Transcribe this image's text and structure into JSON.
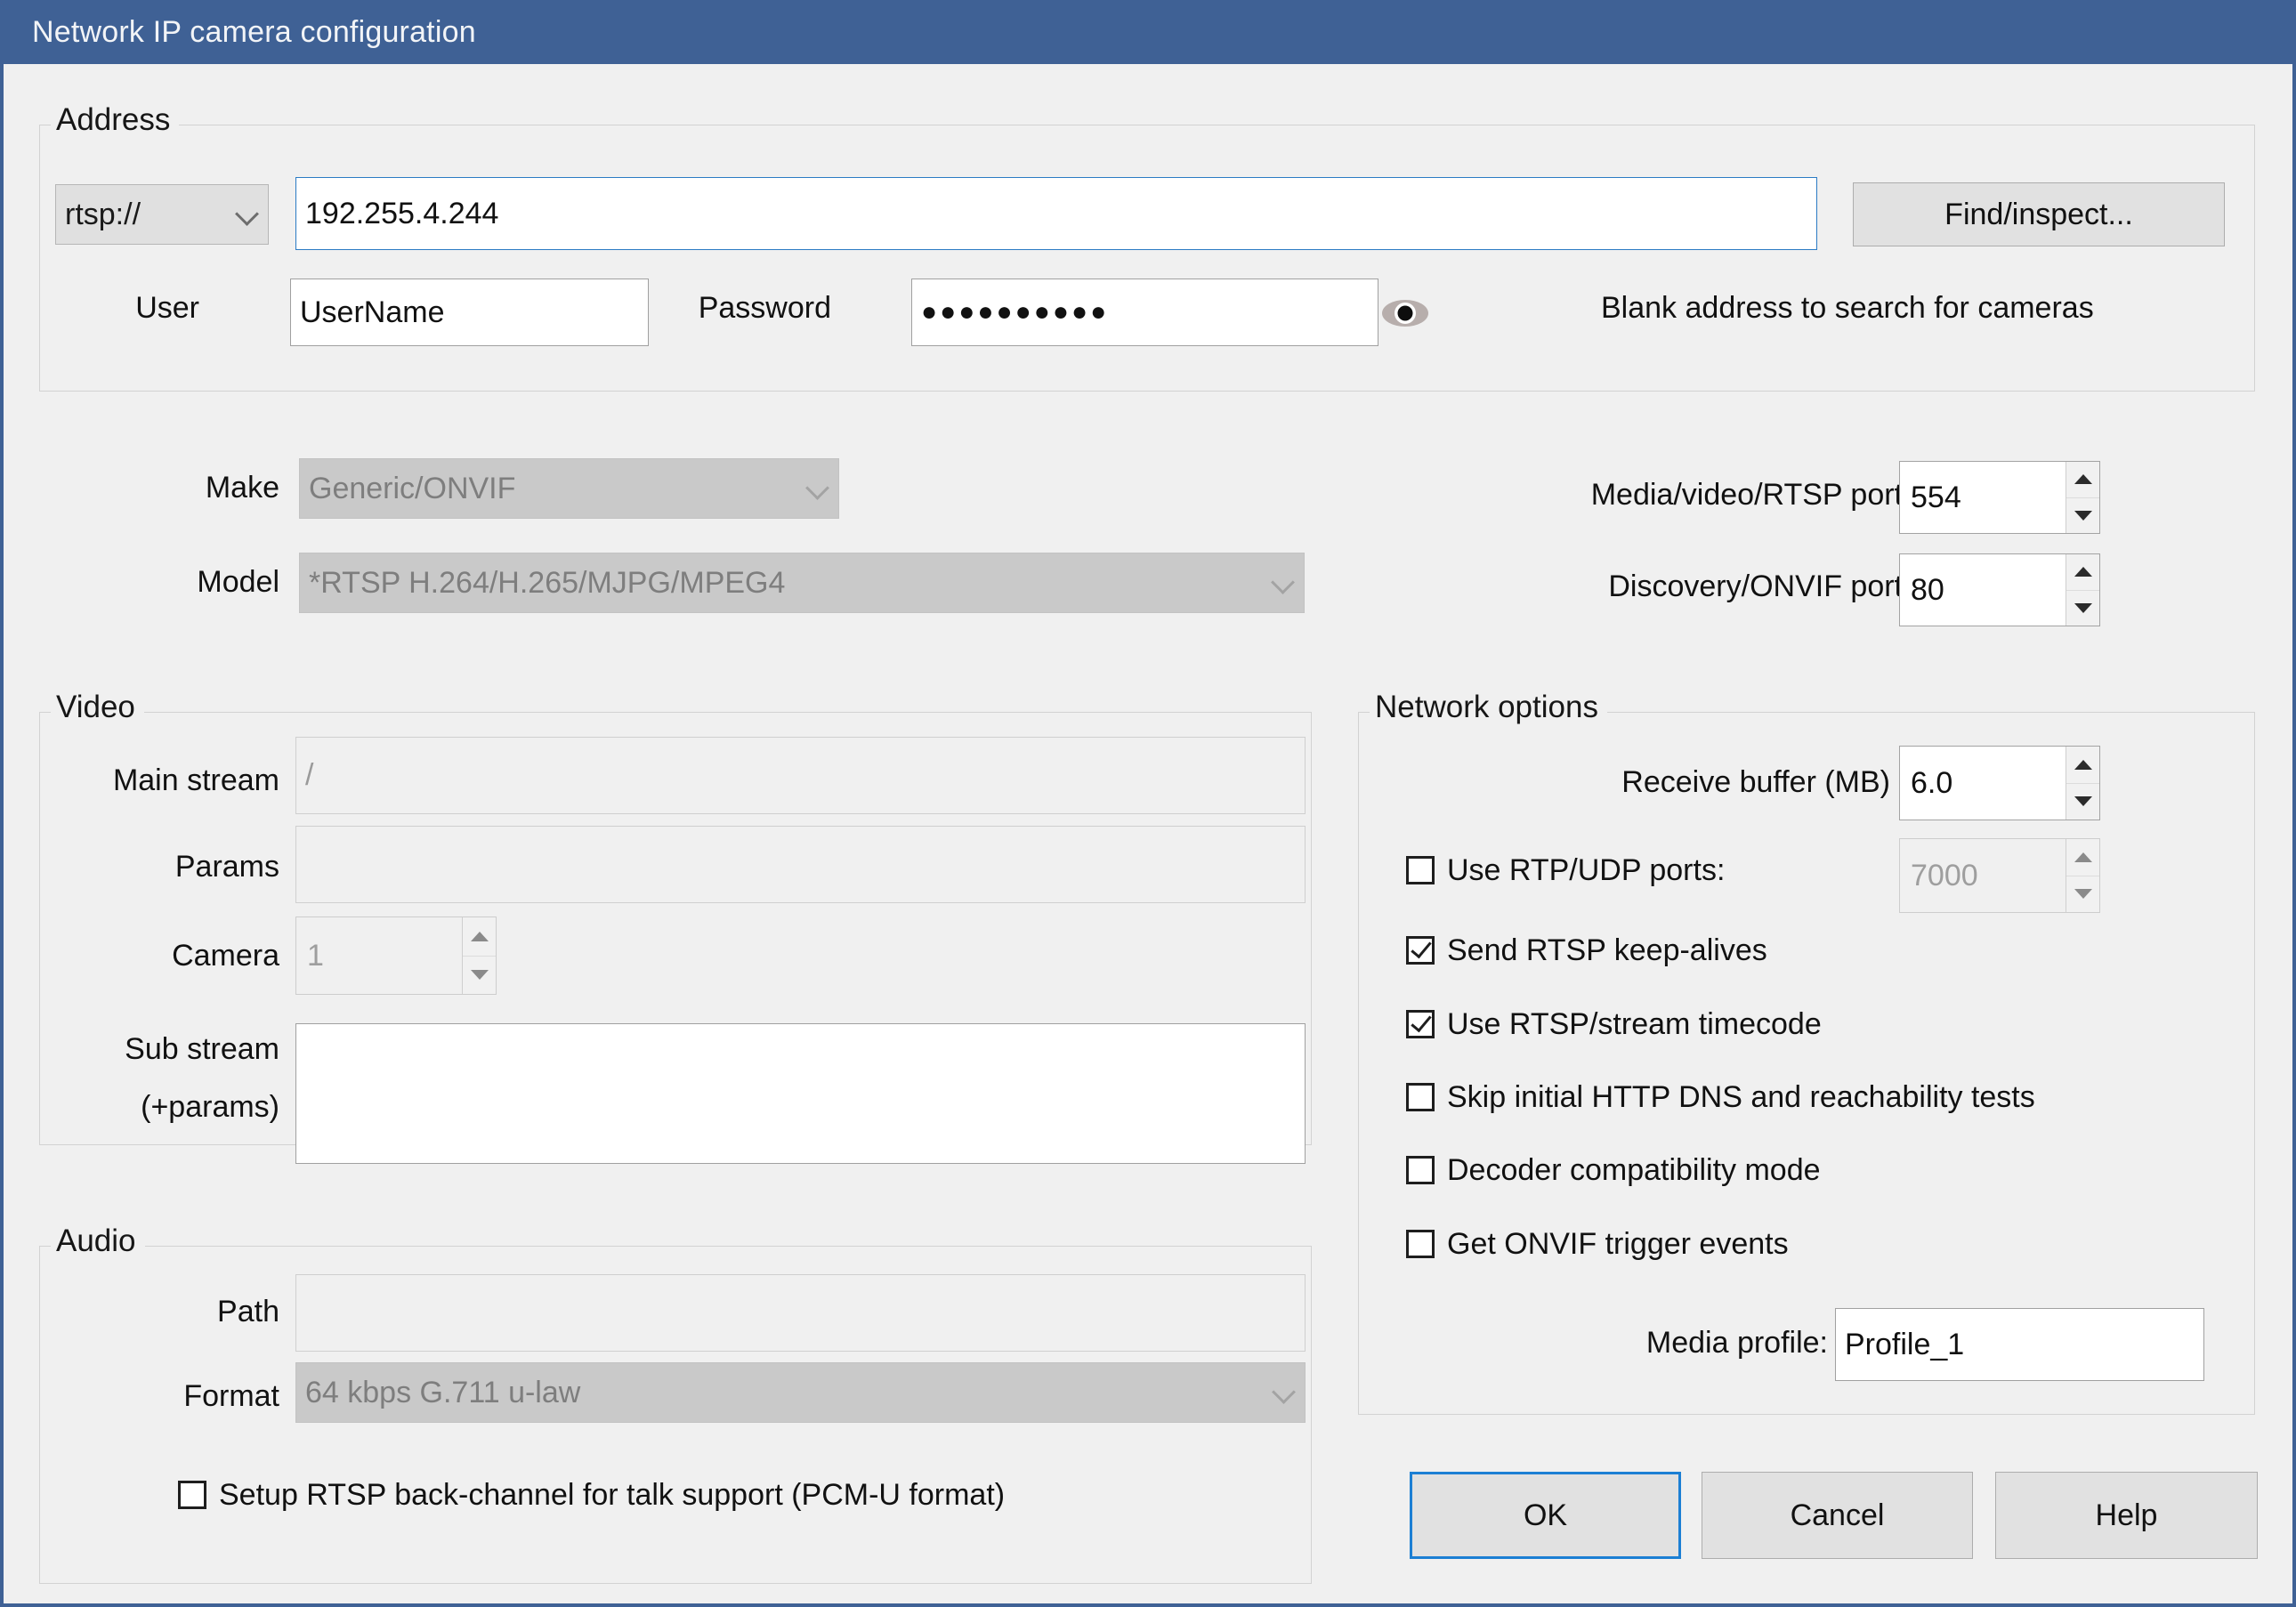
{
  "window": {
    "title": "Network IP camera configuration"
  },
  "address": {
    "group_label": "Address",
    "scheme": "rtsp://",
    "host_value": "192.255.4.244",
    "find_button": "Find/inspect...",
    "user_label": "User",
    "user_value": "UserName",
    "password_label": "Password",
    "password_value": "●●●●●●●●●●",
    "reveal_icon": "eye-icon",
    "hint": "Blank address to search for cameras"
  },
  "device": {
    "make_label": "Make",
    "make_value": "Generic/ONVIF",
    "model_label": "Model",
    "model_value": "*RTSP H.264/H.265/MJPG/MPEG4",
    "media_port_label": "Media/video/RTSP port",
    "media_port_value": "554",
    "discovery_port_label": "Discovery/ONVIF port",
    "discovery_port_value": "80"
  },
  "video": {
    "group_label": "Video",
    "main_stream_label": "Main stream",
    "main_stream_value": "/",
    "params_label": "Params",
    "params_value": "",
    "camera_label": "Camera",
    "camera_value": "1",
    "sub_stream_label_line1": "Sub stream",
    "sub_stream_label_line2": "(+params)",
    "sub_stream_value": ""
  },
  "audio": {
    "group_label": "Audio",
    "path_label": "Path",
    "path_value": "",
    "format_label": "Format",
    "format_value": "64 kbps G.711 u-law",
    "backchannel_label": "Setup RTSP back-channel for talk support (PCM-U format)",
    "backchannel_checked": false
  },
  "network": {
    "group_label": "Network options",
    "receive_buffer_label": "Receive buffer (MB)",
    "receive_buffer_value": "6.0",
    "options": [
      {
        "label": "Use RTP/UDP ports:",
        "checked": false
      },
      {
        "label": "Send RTSP keep-alives",
        "checked": true
      },
      {
        "label": "Use RTSP/stream timecode",
        "checked": true
      },
      {
        "label": "Skip initial HTTP DNS and reachability tests",
        "checked": false
      },
      {
        "label": "Decoder compatibility mode",
        "checked": false
      },
      {
        "label": "Get ONVIF trigger events",
        "checked": false
      }
    ],
    "udp_port_value": "7000",
    "media_profile_label": "Media profile:",
    "media_profile_value": "Profile_1"
  },
  "footer": {
    "ok": "OK",
    "cancel": "Cancel",
    "help": "Help"
  },
  "colors": {
    "titlebar": "#3f6195",
    "accent_focus": "#1c7fd4",
    "dialog_bg": "#f0f0f0"
  }
}
